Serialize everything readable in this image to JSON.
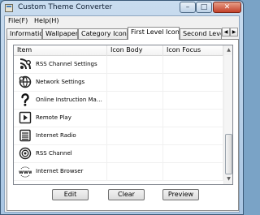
{
  "window": {
    "title": "Custom Theme Converter",
    "controls": {
      "minimize": "–",
      "maximize": "□",
      "close": "✕"
    }
  },
  "menu": [
    "File(F)",
    "Help(H)"
  ],
  "tabs": [
    "Information",
    "Wallpaper",
    "Category Icons",
    "First Level Icons",
    "Second Level Ic"
  ],
  "active_tab": "First Level Icons",
  "tab_scroll": {
    "left": "◀",
    "right": "▶"
  },
  "list": {
    "columns": [
      "Item",
      "Icon Body",
      "Icon Focus"
    ],
    "rows": [
      {
        "label": "RSS Channel Settings",
        "icon": "rss-settings-icon"
      },
      {
        "label": "Network Settings",
        "icon": "network-settings-icon"
      },
      {
        "label": "Online Instruction Manu...",
        "icon": "question-mark-icon"
      },
      {
        "label": "Remote Play",
        "icon": "remote-play-icon"
      },
      {
        "label": "Internet Radio",
        "icon": "internet-radio-icon"
      },
      {
        "label": "RSS Channel",
        "icon": "rss-channel-icon"
      },
      {
        "label": "Internet Browser",
        "icon": "internet-browser-icon"
      }
    ],
    "scrollbar": {
      "up": "▲",
      "down": "▼"
    }
  },
  "buttons": {
    "edit": "Edit",
    "clear": "Clear",
    "preview": "Preview"
  }
}
